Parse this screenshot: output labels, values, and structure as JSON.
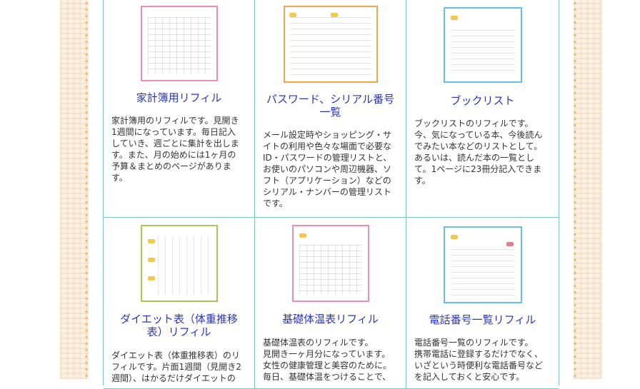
{
  "colors": {
    "title": "#2a35c7",
    "border": "#7fc6c8",
    "thumb_pink": "#f08ab8",
    "thumb_orange": "#f2a54a",
    "thumb_blue": "#67bfe8",
    "thumb_green": "#a9c84f",
    "tag_yellow": "#f5c84c"
  },
  "cards": [
    {
      "title": "家計簿用リフィル",
      "description": "家計簿用のリフィルです。見開き\n1週間になっています。毎日記入\nしていき、週ごとに集計を出しま\nす。また、月の始めには1ヶ月の\n予算＆まとめのページがありま\nす。",
      "thumb_color": "pink"
    },
    {
      "title": "パスワード、シリアル番号一覧",
      "description": "メール設定時やショッピング・サ\nイトの利用や色々な場面で必要な\nID・パスワードの管理リストと、\nお使いのパソコンや周辺機器、ソ\nフト（アプリケーション）などの\nシリアル・ナンバーの管理リスト\nです。",
      "thumb_color": "orange"
    },
    {
      "title": "ブックリスト",
      "description": "ブックリストのリフィルです。\n今、気になっている本、今後読ん\nでみたい本などのリストとして。\nあるいは、読んだ本の一覧とし\nて。1ページに23冊分記入できま\nす。",
      "thumb_color": "blue"
    },
    {
      "title": "ダイエット表（体重推移表）リフィル",
      "description": "ダイエット表（体重推移表）のリ\nフィルです。片面1週間（見開き2\n週間）、はかるだけダイエットの",
      "thumb_color": "green"
    },
    {
      "title": "基礎体温表リフィル",
      "description": "基礎体温表のリフィルです。\n見開き一ヶ月分になっています。\n女性の健康管理と美容のために。\n毎日、基礎体温をつけることで、",
      "thumb_color": "pink"
    },
    {
      "title": "電話番号一覧リフィル",
      "description": "電話番号一覧のリフィルです。\n携帯電話に登録するだけでなく、\nいざという時便利な電話番号など\nを記入しておくと安心です。",
      "thumb_color": "blue"
    }
  ]
}
